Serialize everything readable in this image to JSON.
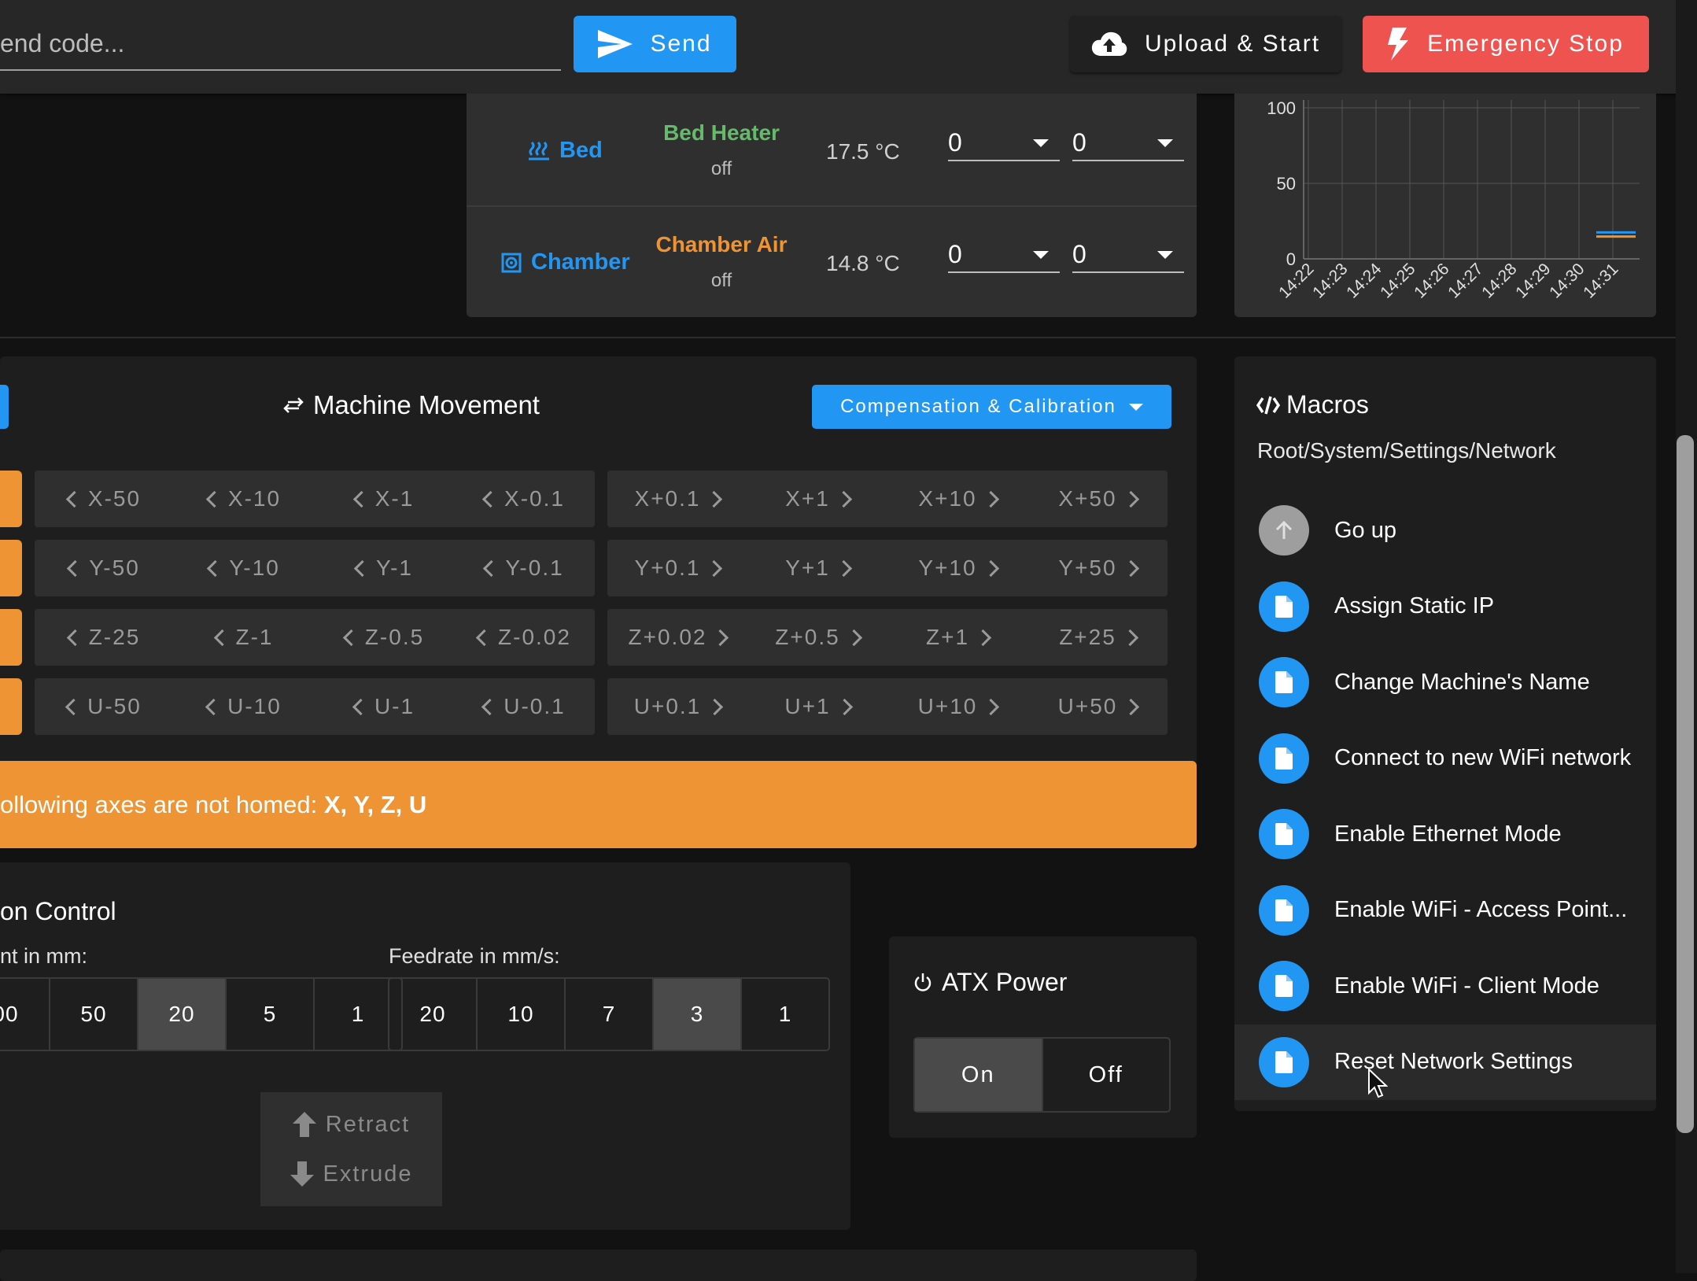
{
  "topbar": {
    "gcode_placeholder": "end code...",
    "send_label": "Send",
    "upload_label": "Upload & Start",
    "estop_label": "Emergency Stop"
  },
  "heaters": [
    {
      "name": "Bed",
      "label": "Bed Heater",
      "state": "off",
      "temp": "17.5 °C",
      "active": "0",
      "standby": "0",
      "label_color": "#66bb6a",
      "icon": "heater-icon"
    },
    {
      "name": "Chamber",
      "label": "Chamber Air",
      "state": "off",
      "temp": "14.8 °C",
      "active": "0",
      "standby": "0",
      "label_color": "#ef9435",
      "icon": "chamber-icon"
    }
  ],
  "chart_data": {
    "type": "line",
    "y_ticks": [
      "100",
      "50",
      "0"
    ],
    "x_ticks": [
      "14:22",
      "14:23",
      "14:24",
      "14:25",
      "14:26",
      "14:27",
      "14:28",
      "14:29",
      "14:30",
      "14:31"
    ],
    "ylim": [
      0,
      100
    ],
    "series": [
      {
        "color": "#2196f3",
        "values": [
          17.5,
          17.5
        ]
      },
      {
        "color": "#ef9435",
        "values": [
          14.8,
          14.8
        ]
      }
    ]
  },
  "movement": {
    "title": "Machine Movement",
    "comp_label": "Compensation & Calibration",
    "rows": [
      {
        "neg": [
          "X-50",
          "X-10",
          "X-1",
          "X-0.1"
        ],
        "pos": [
          "X+0.1",
          "X+1",
          "X+10",
          "X+50"
        ]
      },
      {
        "neg": [
          "Y-50",
          "Y-10",
          "Y-1",
          "Y-0.1"
        ],
        "pos": [
          "Y+0.1",
          "Y+1",
          "Y+10",
          "Y+50"
        ]
      },
      {
        "neg": [
          "Z-25",
          "Z-1",
          "Z-0.5",
          "Z-0.02"
        ],
        "pos": [
          "Z+0.02",
          "Z+0.5",
          "Z+1",
          "Z+25"
        ]
      },
      {
        "neg": [
          "U-50",
          "U-10",
          "U-1",
          "U-0.1"
        ],
        "pos": [
          "U+0.1",
          "U+1",
          "U+10",
          "U+50"
        ]
      }
    ]
  },
  "warning": {
    "prefix": "ollowing axes are not homed: ",
    "axes": "X, Y, Z, U"
  },
  "extrusion": {
    "title": "on Control",
    "amount_label": "nt in mm:",
    "amounts": [
      "00",
      "50",
      "20",
      "5",
      "1"
    ],
    "amount_selected": 2,
    "feed_label": "Feedrate in mm/s:",
    "feeds": [
      "20",
      "10",
      "7",
      "3",
      "1"
    ],
    "feed_selected": 3,
    "retract_label": "Retract",
    "extrude_label": "Extrude"
  },
  "atx": {
    "title": "ATX Power",
    "on": "On",
    "off": "Off",
    "selected": "on"
  },
  "macros": {
    "title": "Macros",
    "path": "Root/System/Settings/Network",
    "items": [
      {
        "label": "Go up",
        "kind": "up"
      },
      {
        "label": "Assign Static IP",
        "kind": "file"
      },
      {
        "label": "Change Machine's Name",
        "kind": "file"
      },
      {
        "label": "Connect to new WiFi network",
        "kind": "file"
      },
      {
        "label": "Enable Ethernet Mode",
        "kind": "file"
      },
      {
        "label": "Enable WiFi - Access Point...",
        "kind": "file"
      },
      {
        "label": "Enable WiFi - Client Mode",
        "kind": "file"
      },
      {
        "label": "Reset Network Settings",
        "kind": "file"
      }
    ]
  }
}
